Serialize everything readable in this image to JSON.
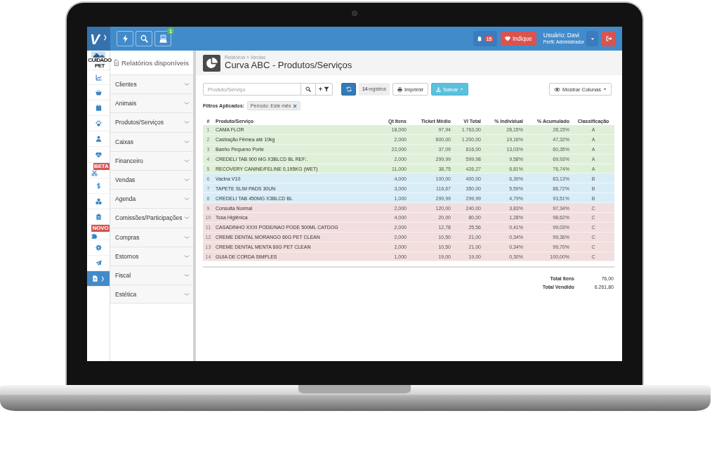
{
  "top_bar": {
    "logo": "V",
    "register_badge": "1",
    "notification_count": "15",
    "refer_button": "Indique",
    "user": "Usuário: Davi",
    "profile": "Perfil: Administrador"
  },
  "sidebar": {
    "brand": "CUIDADO PET",
    "nav": [
      {
        "selected": false
      },
      {
        "selected": false
      },
      {
        "selected": false
      },
      {
        "selected": false
      },
      {
        "selected": false
      },
      {
        "selected": false
      },
      {
        "selected": false,
        "badge": "BETA"
      },
      {
        "selected": false
      },
      {
        "selected": false
      },
      {
        "selected": false
      },
      {
        "selected": false,
        "badge": "NOVO"
      },
      {
        "selected": false
      },
      {
        "selected": false
      },
      {
        "selected": true
      }
    ]
  },
  "reports_menu": {
    "title": "Relatórios disponíveis",
    "items": [
      {
        "label": "Clientes",
        "expanded": false
      },
      {
        "label": "Animais",
        "expanded": false
      },
      {
        "label": "Produtos/Serviços",
        "expanded": false
      },
      {
        "label": "Caixas",
        "expanded": false
      },
      {
        "label": "Financeiro",
        "expanded": false
      },
      {
        "label": "Vendas",
        "expanded": false
      },
      {
        "label": "Agenda",
        "expanded": false
      },
      {
        "label": "Comissões/Participações",
        "expanded": false
      },
      {
        "label": "Compras",
        "expanded": false
      },
      {
        "label": "Estornos",
        "expanded": false
      },
      {
        "label": "Fiscal",
        "expanded": false
      },
      {
        "label": "Estética",
        "expanded": false
      }
    ]
  },
  "page": {
    "breadcrumb": "Relatórios » Vendas",
    "title": "Curva ABC - Produtos/Serviços"
  },
  "toolbar": {
    "search": {
      "placeholder": "Produto/Serviço"
    },
    "add_filter": "+",
    "record_count": "**14** registros",
    "print": "Imprimir",
    "save": "Salvar",
    "columns": "Mostrar Colunas"
  },
  "filters": {
    "label": "Filtros Aplicados:",
    "tags": [
      "Período: Este mês"
    ]
  },
  "table": {
    "columns": [
      "#",
      "Produto/Serviço",
      "Qt Itens",
      "Ticket Médio",
      "Vl Total",
      "% Individual",
      "% Acumulado",
      "Classificação"
    ],
    "rows": [
      {
        "color": "#dff0d8",
        "cells": [
          "1",
          "CAMA FLOR",
          "18,000",
          "97,94",
          "1.763,00",
          "28,15%",
          "28,15%",
          "A"
        ]
      },
      {
        "color": "#dff0d8",
        "cells": [
          "2",
          "Castração Fêmea até 10kg",
          "2,000",
          "600,00",
          "1.200,00",
          "19,16%",
          "47,32%",
          "A"
        ]
      },
      {
        "color": "#dff0d8",
        "cells": [
          "3",
          "Banho Pequeno Porte",
          "22,000",
          "37,09",
          "816,00",
          "13,03%",
          "60,35%",
          "A"
        ]
      },
      {
        "color": "#dff0d8",
        "cells": [
          "4",
          "CREDELI TAB 900 MG X3BLCD BL REF:.",
          "2,000",
          "299,99",
          "599,98",
          "9,58%",
          "69,93%",
          "A"
        ]
      },
      {
        "color": "#dff0d8",
        "cells": [
          "5",
          "RECOVERY CANINE/FELINE 0,195KG (WET)",
          "11,000",
          "38,75",
          "426,27",
          "6,81%",
          "76,74%",
          "A"
        ]
      },
      {
        "color": "#d9edf7",
        "cells": [
          "6",
          "Vacina V10",
          "4,000",
          "100,00",
          "400,00",
          "6,39%",
          "83,13%",
          "B"
        ]
      },
      {
        "color": "#d9edf7",
        "cells": [
          "7",
          "TAPETE SLIM PADS 30UN",
          "3,000",
          "116,67",
          "350,00",
          "5,59%",
          "88,72%",
          "B"
        ]
      },
      {
        "color": "#d9edf7",
        "cells": [
          "8",
          "CREDELI TAB 450MG X3BLCD BL",
          "1,000",
          "299,99",
          "299,99",
          "4,79%",
          "93,51%",
          "B"
        ]
      },
      {
        "color": "#f2dede",
        "cells": [
          "9",
          "Consulta Normal",
          "2,000",
          "120,00",
          "240,00",
          "3,83%",
          "97,34%",
          "C"
        ]
      },
      {
        "color": "#f2dede",
        "cells": [
          "10",
          "Tosa Higiênica",
          "4,000",
          "20,00",
          "80,00",
          "1,28%",
          "98,62%",
          "C"
        ]
      },
      {
        "color": "#f2dede",
        "cells": [
          "11",
          "CASADINHO XXXI PODE/NAO PODE 500ML CATDOG",
          "2,000",
          "12,78",
          "25,56",
          "0,41%",
          "99,03%",
          "C"
        ]
      },
      {
        "color": "#f2dede",
        "cells": [
          "12",
          "CREME DENTAL MORANGO 60G PET CLEAN",
          "2,000",
          "10,50",
          "21,00",
          "0,34%",
          "99,36%",
          "C"
        ]
      },
      {
        "color": "#f2dede",
        "cells": [
          "13",
          "CREME DENTAL MENTA 60G PET CLEAN",
          "2,000",
          "10,50",
          "21,00",
          "0,34%",
          "99,70%",
          "C"
        ]
      },
      {
        "color": "#f2dede",
        "cells": [
          "14",
          "GUIA DE CORDA SIMPLES",
          "1,000",
          "19,00",
          "19,00",
          "0,30%",
          "100,00%",
          "C"
        ]
      }
    ]
  },
  "totals": [
    {
      "label": "Total Itens",
      "value": "76,00"
    },
    {
      "label": "Total Vendido",
      "value": "6.261,80"
    }
  ]
}
